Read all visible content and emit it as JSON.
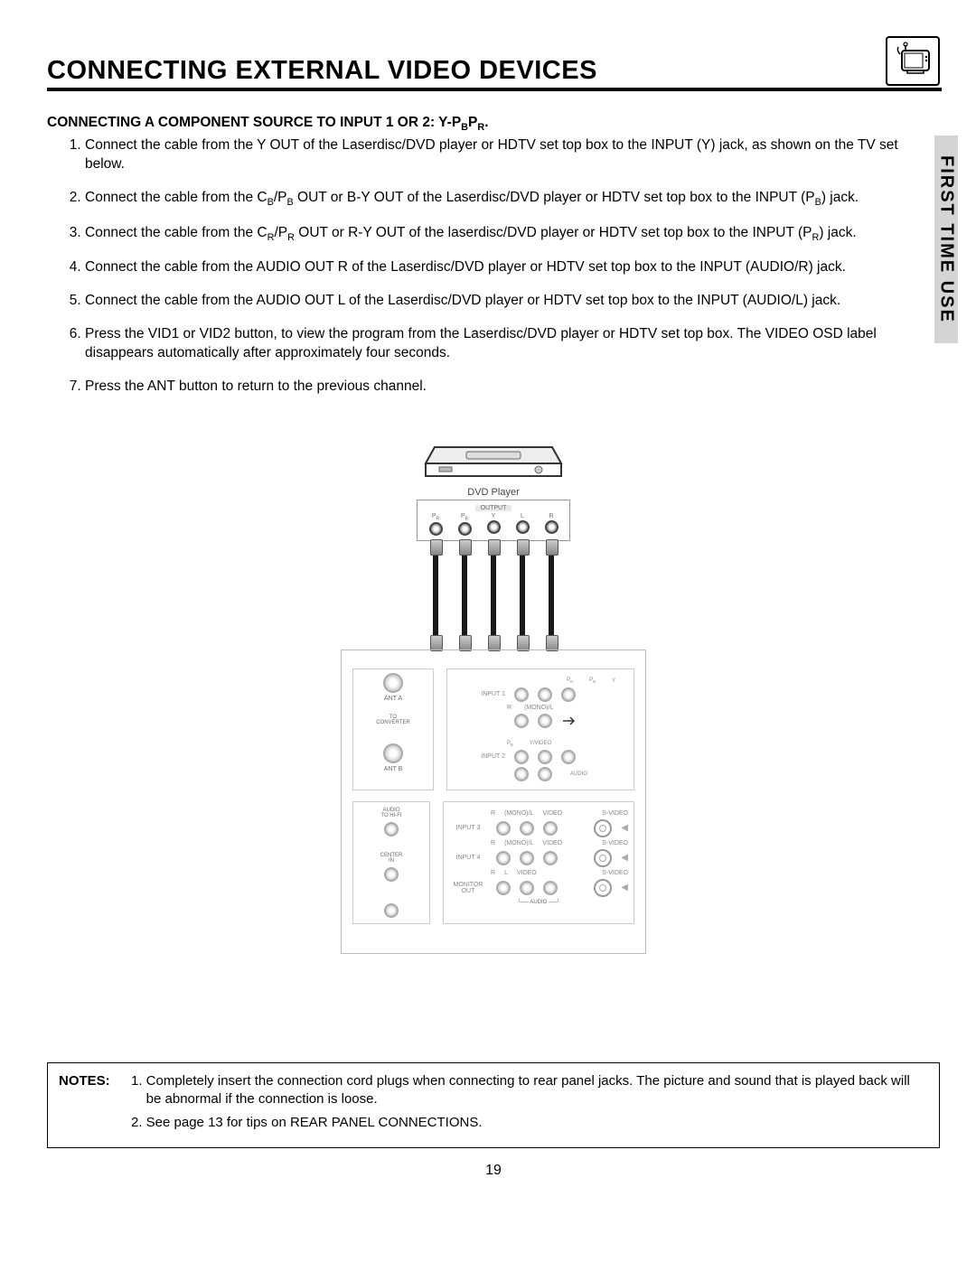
{
  "header": {
    "title": "CONNECTING EXTERNAL VIDEO DEVICES"
  },
  "side_tab": "FIRST TIME USE",
  "subheading_prefix": "CONNECTING A COMPONENT SOURCE TO INPUT 1 OR 2:  Y-P",
  "subheading_sub1": "B",
  "subheading_mid": "P",
  "subheading_sub2": "R",
  "subheading_suffix": ".",
  "steps": [
    "Connect the cable from the Y OUT of the Laserdisc/DVD player or HDTV set top box to the INPUT (Y) jack, as shown on the TV set below.",
    "Connect the cable from the C_B/P_B OUT or B-Y OUT of the Laserdisc/DVD player or HDTV set top box to the INPUT (P_B) jack.",
    "Connect the cable from the C_R/P_R OUT or R-Y OUT of the laserdisc/DVD player or HDTV set top box to the INPUT (P_R) jack.",
    "Connect the cable from the AUDIO OUT R of the Laserdisc/DVD player or  HDTV set top box to the INPUT (AUDIO/R) jack.",
    "Connect the cable from the AUDIO OUT L of the Laserdisc/DVD player or HDTV set top box to the INPUT (AUDIO/L) jack.",
    "Press the VID1 or VID2 button, to view the program from the Laserdisc/DVD player or HDTV set top box.  The VIDEO OSD label disappears automatically after approximately four seconds.",
    "Press the ANT button to return to the previous channel."
  ],
  "diagram": {
    "dvd_label": "DVD Player",
    "output_label": "OUTPUT",
    "output_jacks": [
      "P_R",
      "P_B",
      "Y",
      "L",
      "R"
    ],
    "panel": {
      "ant_a": "ANT A",
      "to_converter": "TO\nCONVERTER",
      "ant_b": "ANT B",
      "input1": "INPUT 1",
      "input2": "INPUT 2",
      "input3": "INPUT 3",
      "input4": "INPUT 4",
      "monitor_out": "MONITOR\nOUT",
      "audio_hifi": "AUDIO\nTO HI-FI",
      "center_in": "CENTER\nIN",
      "r": "R",
      "mono_l": "(MONO)/L",
      "video": "VIDEO",
      "svideo": "S-VIDEO",
      "yvideo": "Y/VIDEO",
      "audio": "AUDIO",
      "pb": "P_B",
      "pr": "P_R",
      "y": "Y",
      "bottom_audio": "AUDIO"
    }
  },
  "notes": {
    "label": "NOTES:",
    "items": [
      "Completely insert the connection cord plugs when connecting to rear panel jacks.  The picture and sound that is played back will be abnormal if the connection is loose.",
      "See page 13 for tips on REAR PANEL CONNECTIONS."
    ]
  },
  "page_number": "19"
}
